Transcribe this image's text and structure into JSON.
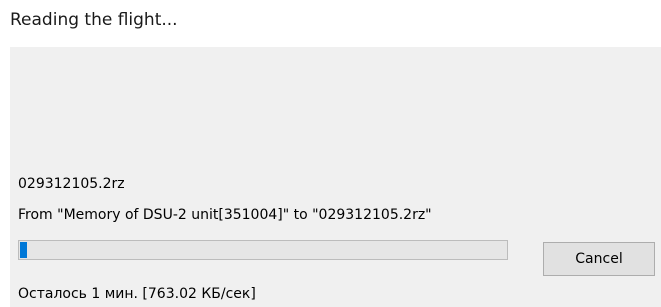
{
  "dialog": {
    "title": "Reading the flight...",
    "file_name": "029312105.2rz",
    "transfer_text": "From \"Memory of DSU-2 unit[351004]\" to \"029312105.2rz\"",
    "progress_fraction": 0.015,
    "progress_color": "#0078d7",
    "cancel_label": "Cancel",
    "remaining_text": "Осталось 1 мин. [763.02 КБ/сек]"
  }
}
